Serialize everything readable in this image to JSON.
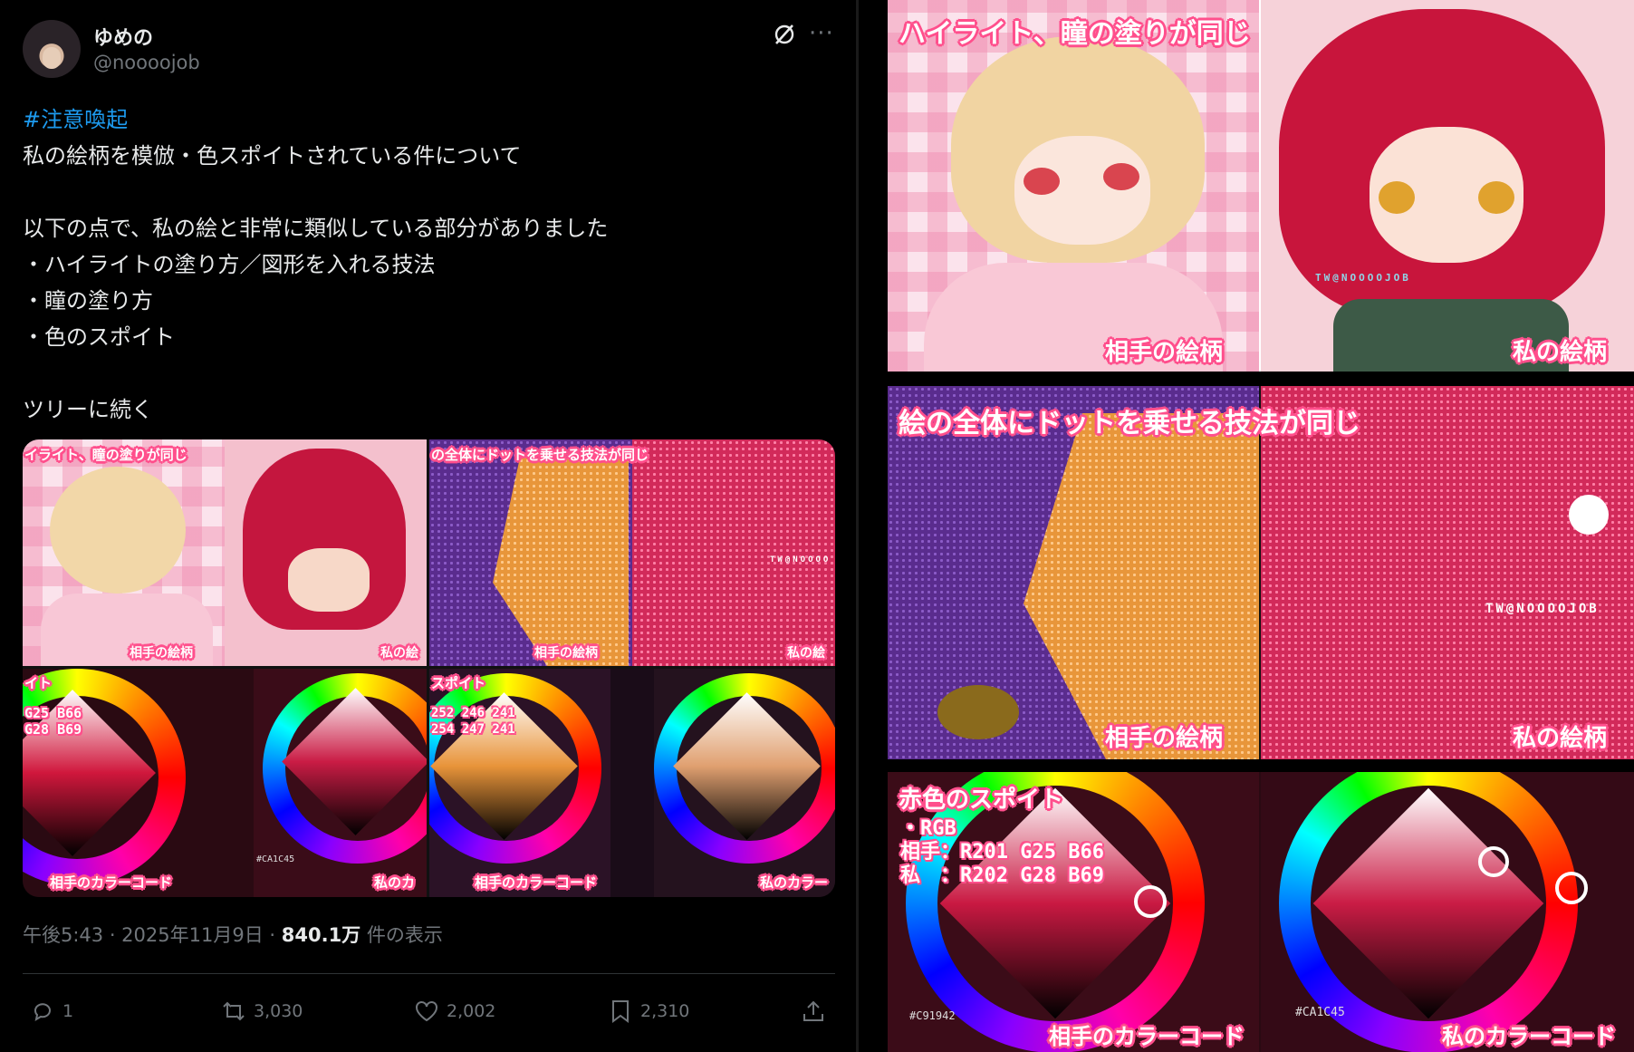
{
  "tweet": {
    "user": {
      "name": "ゆめの",
      "handle": "@noooojob"
    },
    "lines": [
      "#注意喚起",
      "私の絵柄を模倣・色スポイトされている件について",
      "",
      "以下の点で、私の絵と非常に類似している部分がありました",
      "・ハイライトの塗り方／図形を入れる技法",
      "・瞳の塗り方",
      "・色のスポイト",
      "",
      "ツリーに続く"
    ],
    "timestamp": {
      "time": "午後5:43 · 2025年11月9日 · ",
      "views": "840.1万",
      "views_label": " 件の表示"
    },
    "actions": {
      "replies": "1",
      "retweets": "3,030",
      "likes": "2,002",
      "bookmarks": "2,310"
    }
  },
  "panels": {
    "highlight": {
      "caption": "ハイライト、瞳の塗りが同じ",
      "left_label": "相手の絵柄",
      "right_label": "私の絵柄",
      "watermark": "TW@NOOOOJOB"
    },
    "dots": {
      "caption": "絵の全体にドットを乗せる技法が同じ",
      "left_label": "相手の絵柄",
      "right_label": "私の絵柄",
      "watermark": "TW@NOOOOJOB"
    },
    "color": {
      "caption": "赤色のスポイト",
      "rgb_title": "・RGB",
      "rgb_other": "相手：R201 G25 B66",
      "rgb_mine": "私　：R202 G28 B69",
      "left_label": "相手のカラーコード",
      "right_label": "私のカラーコード",
      "left_hex": "#C91942",
      "right_hex": "#CA1C45"
    },
    "spoit_skin": {
      "caption": "スポイト",
      "rgb_values": "252 246 241\n254 247 241"
    },
    "thumb_rgb_values": "G25 B66\nG28 B69",
    "thumb_caption_1": "イライト、瞳の塗りが同じ",
    "thumb_caption_2": "の全体にドットを乗せる技法が同じ",
    "thumb_caption_3": "イト",
    "thumb_watermark": "TW@NOOOO",
    "thumb_right_label": "私の絵",
    "thumb_right_color_label": "私のカ",
    "thumb_right_color_label_2": "私のカラー"
  },
  "colors": {
    "accent_link": "#1d9bf0",
    "caption_outline": "#ff4f8c",
    "muted": "#71767b"
  }
}
